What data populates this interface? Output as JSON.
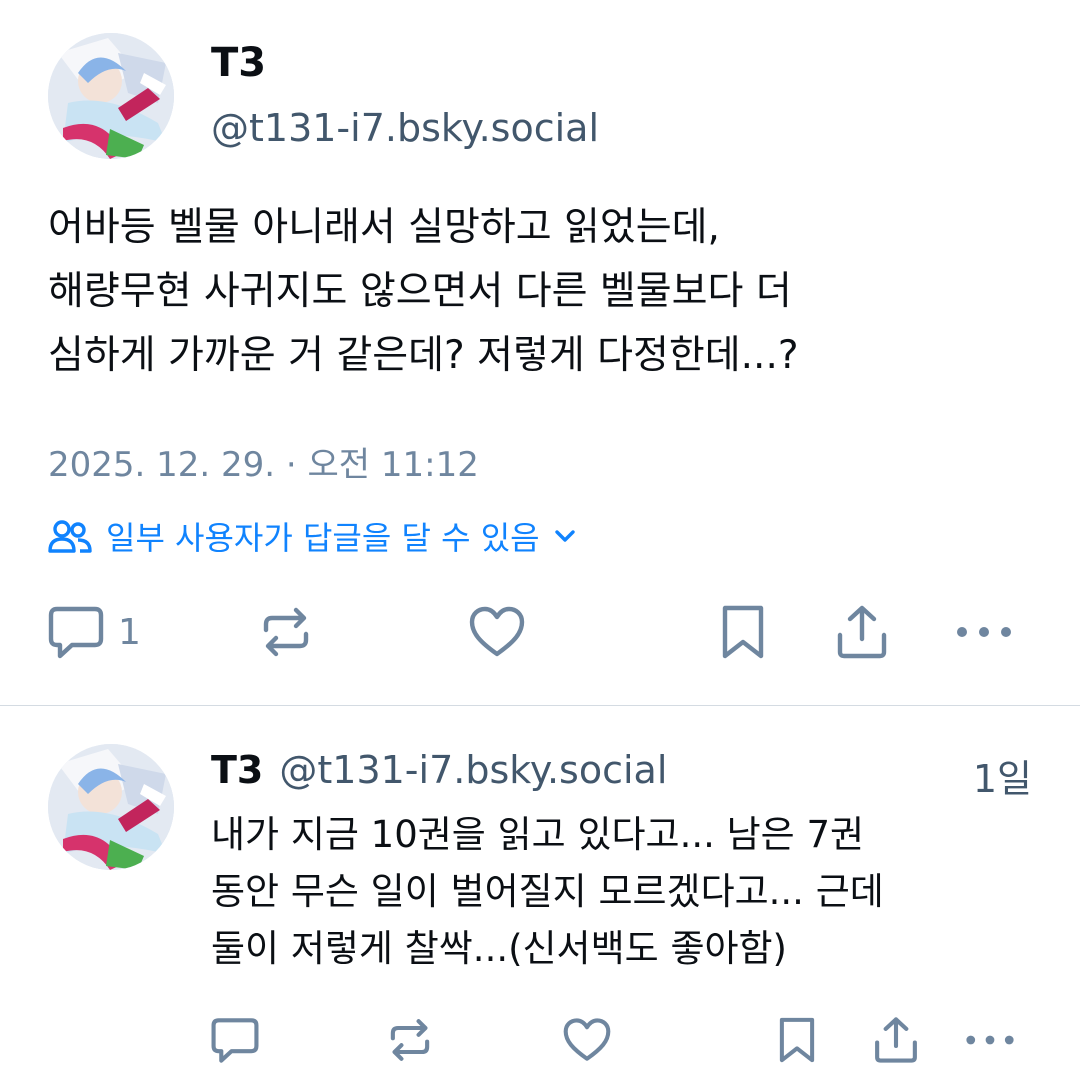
{
  "post": {
    "author": {
      "display_name": "T3",
      "handle": "@t131-i7.bsky.social"
    },
    "text_lines": [
      "어바등 벨물 아니래서 실망하고 읽었는데,",
      "해량무현 사귀지도 않으면서 다른 벨물보다 더",
      "심하게 가까운 거 같은데? 저렇게 다정한데...?"
    ],
    "timestamp": "2025. 12. 29. · 오전 11:12",
    "reply_setting": "일부 사용자가 답글을 달 수 있음",
    "reply_count": "1",
    "icons": {
      "people": "people-icon",
      "chevron": "chevron-down-icon",
      "reply": "reply-icon",
      "repost": "repost-icon",
      "like": "heart-icon",
      "bookmark": "bookmark-icon",
      "share": "share-icon",
      "more": "more-icon"
    }
  },
  "reply": {
    "author": {
      "display_name": "T3",
      "handle": "@t131-i7.bsky.social"
    },
    "time": "1일",
    "text_lines": [
      "내가 지금 10권을 읽고 있다고... 남은 7권",
      "동안 무슨 일이 벌어질지 모르겠다고... 근데",
      "둘이 저렇게 찰싹...(신서백도 좋아함)"
    ]
  },
  "colors": {
    "text": "#0b0f14",
    "muted": "#6f869f",
    "handle": "#42576c",
    "accent": "#1083fe",
    "divider": "#d4dbe2"
  }
}
